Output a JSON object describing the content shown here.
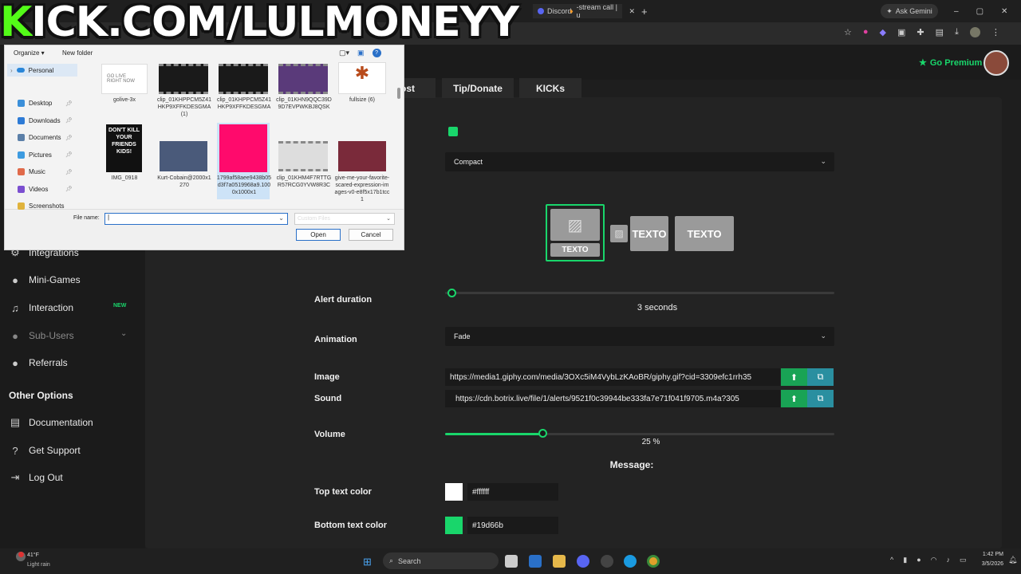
{
  "watermark": {
    "text_k": "K",
    "text_rest": "ICK.COM/LULMONEYY"
  },
  "browser": {
    "tabs": [
      {
        "label": "Discord"
      },
      {
        "label": "-stream call | u"
      }
    ],
    "new_tab": "+",
    "ask_gemini": "Ask Gemini"
  },
  "app": {
    "go_premium": "Go Premium",
    "tabs": [
      {
        "label": "ost"
      },
      {
        "label": "Tip/Donate"
      },
      {
        "label": "KICKs"
      }
    ],
    "sidebar": {
      "items": [
        {
          "label": "Integrations",
          "icon": "puzzle-icon"
        },
        {
          "label": "Mini-Games",
          "icon": "gamepad-icon"
        },
        {
          "label": "Interaction",
          "icon": "music-icon",
          "badge": "NEW"
        },
        {
          "label": "Sub-Users",
          "icon": "users-icon"
        },
        {
          "label": "Referrals",
          "icon": "people-icon"
        }
      ],
      "section_other": "Other Options",
      "other_items": [
        {
          "label": "Documentation",
          "icon": "book-icon"
        },
        {
          "label": "Get Support",
          "icon": "help-icon"
        },
        {
          "label": "Log Out",
          "icon": "logout-icon"
        }
      ]
    },
    "form": {
      "layout_select": "Compact",
      "layout_options": [
        {
          "text": "TEXTO"
        },
        {
          "text": "TEXTO"
        },
        {
          "text": "TEXTO"
        }
      ],
      "alert_duration_label": "Alert duration",
      "alert_duration_value": "3 seconds",
      "animation_label": "Animation",
      "animation_value": "Fade",
      "image_label": "Image",
      "image_url": "https://media1.giphy.com/media/3OXc5iM4VybLzKAoBR/giphy.gif?cid=3309efc1rrh35",
      "sound_label": "Sound",
      "sound_url": "https://cdn.botrix.live/file/1/alerts/9521f0c39944be333fa7e71f041f9705.m4a?305",
      "volume_label": "Volume",
      "volume_value": "25 %",
      "volume_fraction": 0.25,
      "message_label": "Message:",
      "top_text_color_label": "Top text color",
      "top_text_color_value": "#ffffff",
      "bottom_text_color_label": "Bottom text color",
      "bottom_text_color_value": "#19d66b"
    }
  },
  "dialog": {
    "organize": "Organize ▾",
    "new_folder": "New folder",
    "nav_personal": "Personal",
    "quick_access": [
      {
        "label": "Desktop",
        "color": "#3b8fd9"
      },
      {
        "label": "Downloads",
        "color": "#2e7bd6"
      },
      {
        "label": "Documents",
        "color": "#5b7fa8"
      },
      {
        "label": "Pictures",
        "color": "#3d9be0"
      },
      {
        "label": "Music",
        "color": "#e06a4a"
      },
      {
        "label": "Videos",
        "color": "#7b4fd0"
      },
      {
        "label": "Screenshots",
        "color": "#e0b33d"
      }
    ],
    "files_row1": [
      {
        "name": "golive-3x"
      },
      {
        "name": "clip_01KHPPCM5Z41HKP9XFFKDESGMA (1)"
      },
      {
        "name": "clip_01KHPPCM5Z41HKP9XFFKDESGMA"
      },
      {
        "name": "clip_01KHN9QQC39D9D7EVPWKBJ8QSK"
      },
      {
        "name": "fullsize (6)"
      }
    ],
    "files_row2": [
      {
        "name": "IMG_0918",
        "thumb_text": "DON'T KILL YOUR FRIENDS KIDS!"
      },
      {
        "name": "Kurt-Cobain@2000x1270"
      },
      {
        "name": "1799af58aee9438b05d3f7a0519968a9.1000x1000x1"
      },
      {
        "name": "clip_01KHM4F7RTTGR57RCG0YVW8R3C"
      },
      {
        "name": "give-me-your-favorite-scared-expression-images-v0-e8f5x17b1tcc1"
      }
    ],
    "file_name_label": "File name:",
    "file_name_value": "",
    "filter": "Custom Files",
    "open": "Open",
    "cancel": "Cancel"
  },
  "taskbar": {
    "weather_temp": "41°F",
    "weather_desc": "Light rain",
    "search": "Search",
    "time": "1:42 PM",
    "date": "3/5/2026"
  },
  "colors": {
    "accent": "#19d66b",
    "kick_green": "#53fc18",
    "pink_thumb": "#ff0a6c"
  }
}
